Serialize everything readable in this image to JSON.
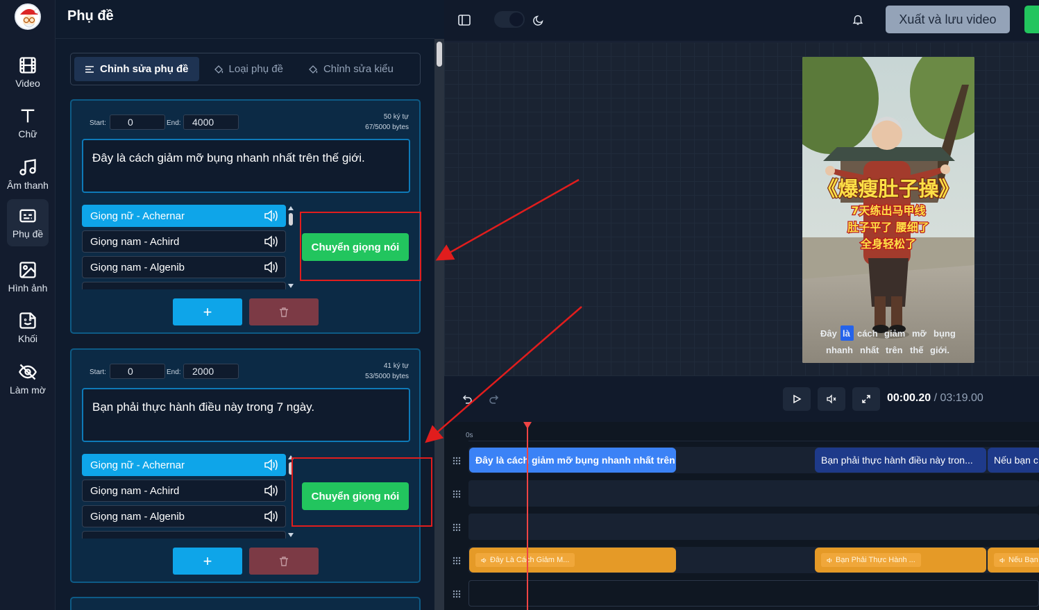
{
  "sidebar": {
    "items": [
      {
        "label": "Video",
        "icon": "film-icon"
      },
      {
        "label": "Chữ",
        "icon": "text-icon"
      },
      {
        "label": "Âm thanh",
        "icon": "music-icon"
      },
      {
        "label": "Phụ đề",
        "icon": "subtitles-icon",
        "active": true
      },
      {
        "label": "Hình ảnh",
        "icon": "image-icon"
      },
      {
        "label": "Khối",
        "icon": "sticker-icon"
      },
      {
        "label": "Làm mờ",
        "icon": "eye-off-icon"
      }
    ]
  },
  "panel": {
    "title": "Phụ đề",
    "tabs": [
      {
        "label": "Chỉnh sửa phụ đề",
        "active": true
      },
      {
        "label": "Loại phụ đề"
      },
      {
        "label": "Chỉnh sửa kiểu"
      }
    ],
    "cards": [
      {
        "start_label": "Start:",
        "start": "0",
        "end_label": "End:",
        "end": "4000",
        "chars": "50 ký tự",
        "bytes": "67/5000 bytes",
        "text": "Đây là cách giảm mỡ bụng nhanh nhất trên thế giới.",
        "voices": [
          "Giọng nữ - Achernar",
          "Giọng nam - Achird",
          "Giọng nam - Algenib"
        ],
        "convert_label": "Chuyển giọng nói",
        "add_label": "+"
      },
      {
        "start_label": "Start:",
        "start": "0",
        "end_label": "End:",
        "end": "2000",
        "chars": "41 ký tự",
        "bytes": "53/5000 bytes",
        "text": "Bạn phải thực hành điều này trong 7 ngày.",
        "voices": [
          "Giọng nữ - Achernar",
          "Giọng nam - Achird",
          "Giọng nam - Algenib"
        ],
        "convert_label": "Chuyển giọng nói",
        "add_label": "+"
      }
    ]
  },
  "topbar": {
    "export_label": "Xuất và lưu video"
  },
  "video": {
    "title_text": "《爆瘦肚子操》",
    "line1": "7天练出马甲线",
    "line2": "肚子平了 腰细了",
    "line3": "全身轻松了",
    "caption_words_1": [
      "Đây",
      "là",
      "cách",
      "giảm",
      "mỡ",
      "bụng"
    ],
    "caption_words_2": [
      "nhanh",
      "nhất",
      "trên",
      "thế",
      "giới."
    ]
  },
  "controls": {
    "current_time": "00:00.20",
    "separator": " / ",
    "total_time": "03:19.00"
  },
  "timeline": {
    "ruler_label": "0s",
    "subtitle_clips": [
      "Đây là cách giảm mỡ bụng nhanh nhất trên thế giới.",
      "Bạn phải thực hành điều này tron...",
      "Nếu bạn c"
    ],
    "audio_clips": [
      "Đây Là Cách Giảm M...",
      "Bạn Phải Thực Hành ...",
      "Nếu Bạn"
    ]
  },
  "colors": {
    "accent": "#0ea5e9",
    "convert": "#22c55e",
    "annotation": "#e11d1d",
    "subtitle_clip": "#3b82f6",
    "audio_clip": "#e59a27"
  }
}
